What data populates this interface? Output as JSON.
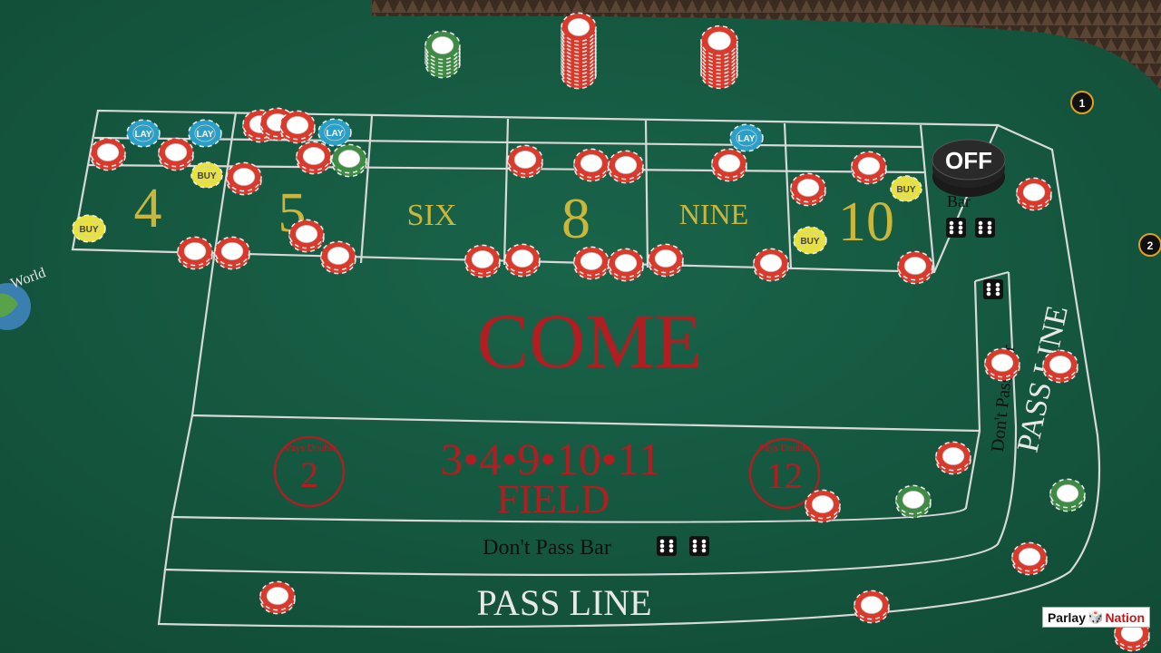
{
  "table": {
    "felt_color": "#15573f",
    "line_color": "#d8d8d8",
    "red_text_color": "#b01e22",
    "gold_text_color": "#c9b63a",
    "white_text_color": "#e8e8e8"
  },
  "place_numbers": [
    "4",
    "5",
    "SIX",
    "8",
    "NINE",
    "10"
  ],
  "come_label": "COME",
  "field": {
    "numbers": "3•4•9•10•11",
    "label": "FIELD",
    "left_circle": {
      "number": "2",
      "caption": "Pays Double"
    },
    "right_circle": {
      "number": "12",
      "caption": "Pays Double"
    }
  },
  "dont_pass_bar_label": "Don't Pass Bar",
  "dont_pass_vertical_label": "Don't Pass Bar",
  "dont_come_bar_label": "Bar",
  "pass_line_label": "PASS LINE",
  "pass_line_vertical_label": "PASS LINE",
  "puck": {
    "label": "OFF"
  },
  "chip_marker_labels": {
    "lay": "LAY",
    "buy": "BUY"
  },
  "player_position_markers": [
    "1",
    "2"
  ],
  "watermark": {
    "brand_name": "Parlay",
    "brand_suffix": "Nation",
    "icon": "dice-icon"
  },
  "side_logo_text": "World",
  "chip_colors": {
    "red": "#d93a2c",
    "green": "#3f8a45",
    "blue": "#2aa0c8",
    "yellow": "#e8e23a",
    "white": "#f4f4f4"
  }
}
